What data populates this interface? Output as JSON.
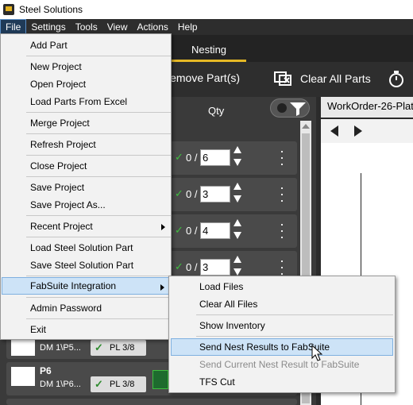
{
  "window": {
    "title": "Steel Solutions"
  },
  "menubar": {
    "items": [
      "File",
      "Settings",
      "Tools",
      "View",
      "Actions",
      "Help"
    ],
    "active": "File"
  },
  "tabs": {
    "nesting": "Nesting"
  },
  "toolbar": {
    "remove_parts": "Remove Part(s)",
    "clear_all_parts": "Clear All Parts"
  },
  "list": {
    "qty_header": "Qty",
    "rows": [
      {
        "cur": "0 /",
        "qty": "6"
      },
      {
        "cur": "0 /",
        "qty": "3"
      },
      {
        "cur": "0 /",
        "qty": "4"
      },
      {
        "cur": "0 /",
        "qty": "3"
      }
    ],
    "lower_rows": [
      {
        "path": "DM 1\\P5...",
        "badge": "PL 3/8"
      },
      {
        "name": "P6",
        "path": "DM 1\\P6...",
        "badge": "PL 3/8"
      }
    ]
  },
  "viewer": {
    "tab_label": "WorkOrder-26-Plat"
  },
  "file_menu": {
    "items": [
      "Add Part",
      "New Project",
      "Open Project",
      "Load Parts From Excel",
      "Merge Project",
      "Refresh Project",
      "Close Project",
      "Save Project",
      "Save Project As...",
      "Recent Project",
      "Load Steel Solution Part",
      "Save Steel Solution Part",
      "FabSuite Integration",
      "Admin Password",
      "Exit"
    ]
  },
  "fabsuite_submenu": {
    "items": [
      "Load Files",
      "Clear All Files",
      "Show Inventory",
      "Send Nest Results to FabSuite",
      "Send Current Nest Result to FabSuite",
      "TFS Cut"
    ],
    "highlighted": "Send Nest Results to FabSuite",
    "disabled": "Send Current Nest Result to FabSuite"
  },
  "colors": {
    "accent": "#e5b825",
    "menu_highlight": "#cde3f7",
    "check_green": "#3fbf3f"
  }
}
